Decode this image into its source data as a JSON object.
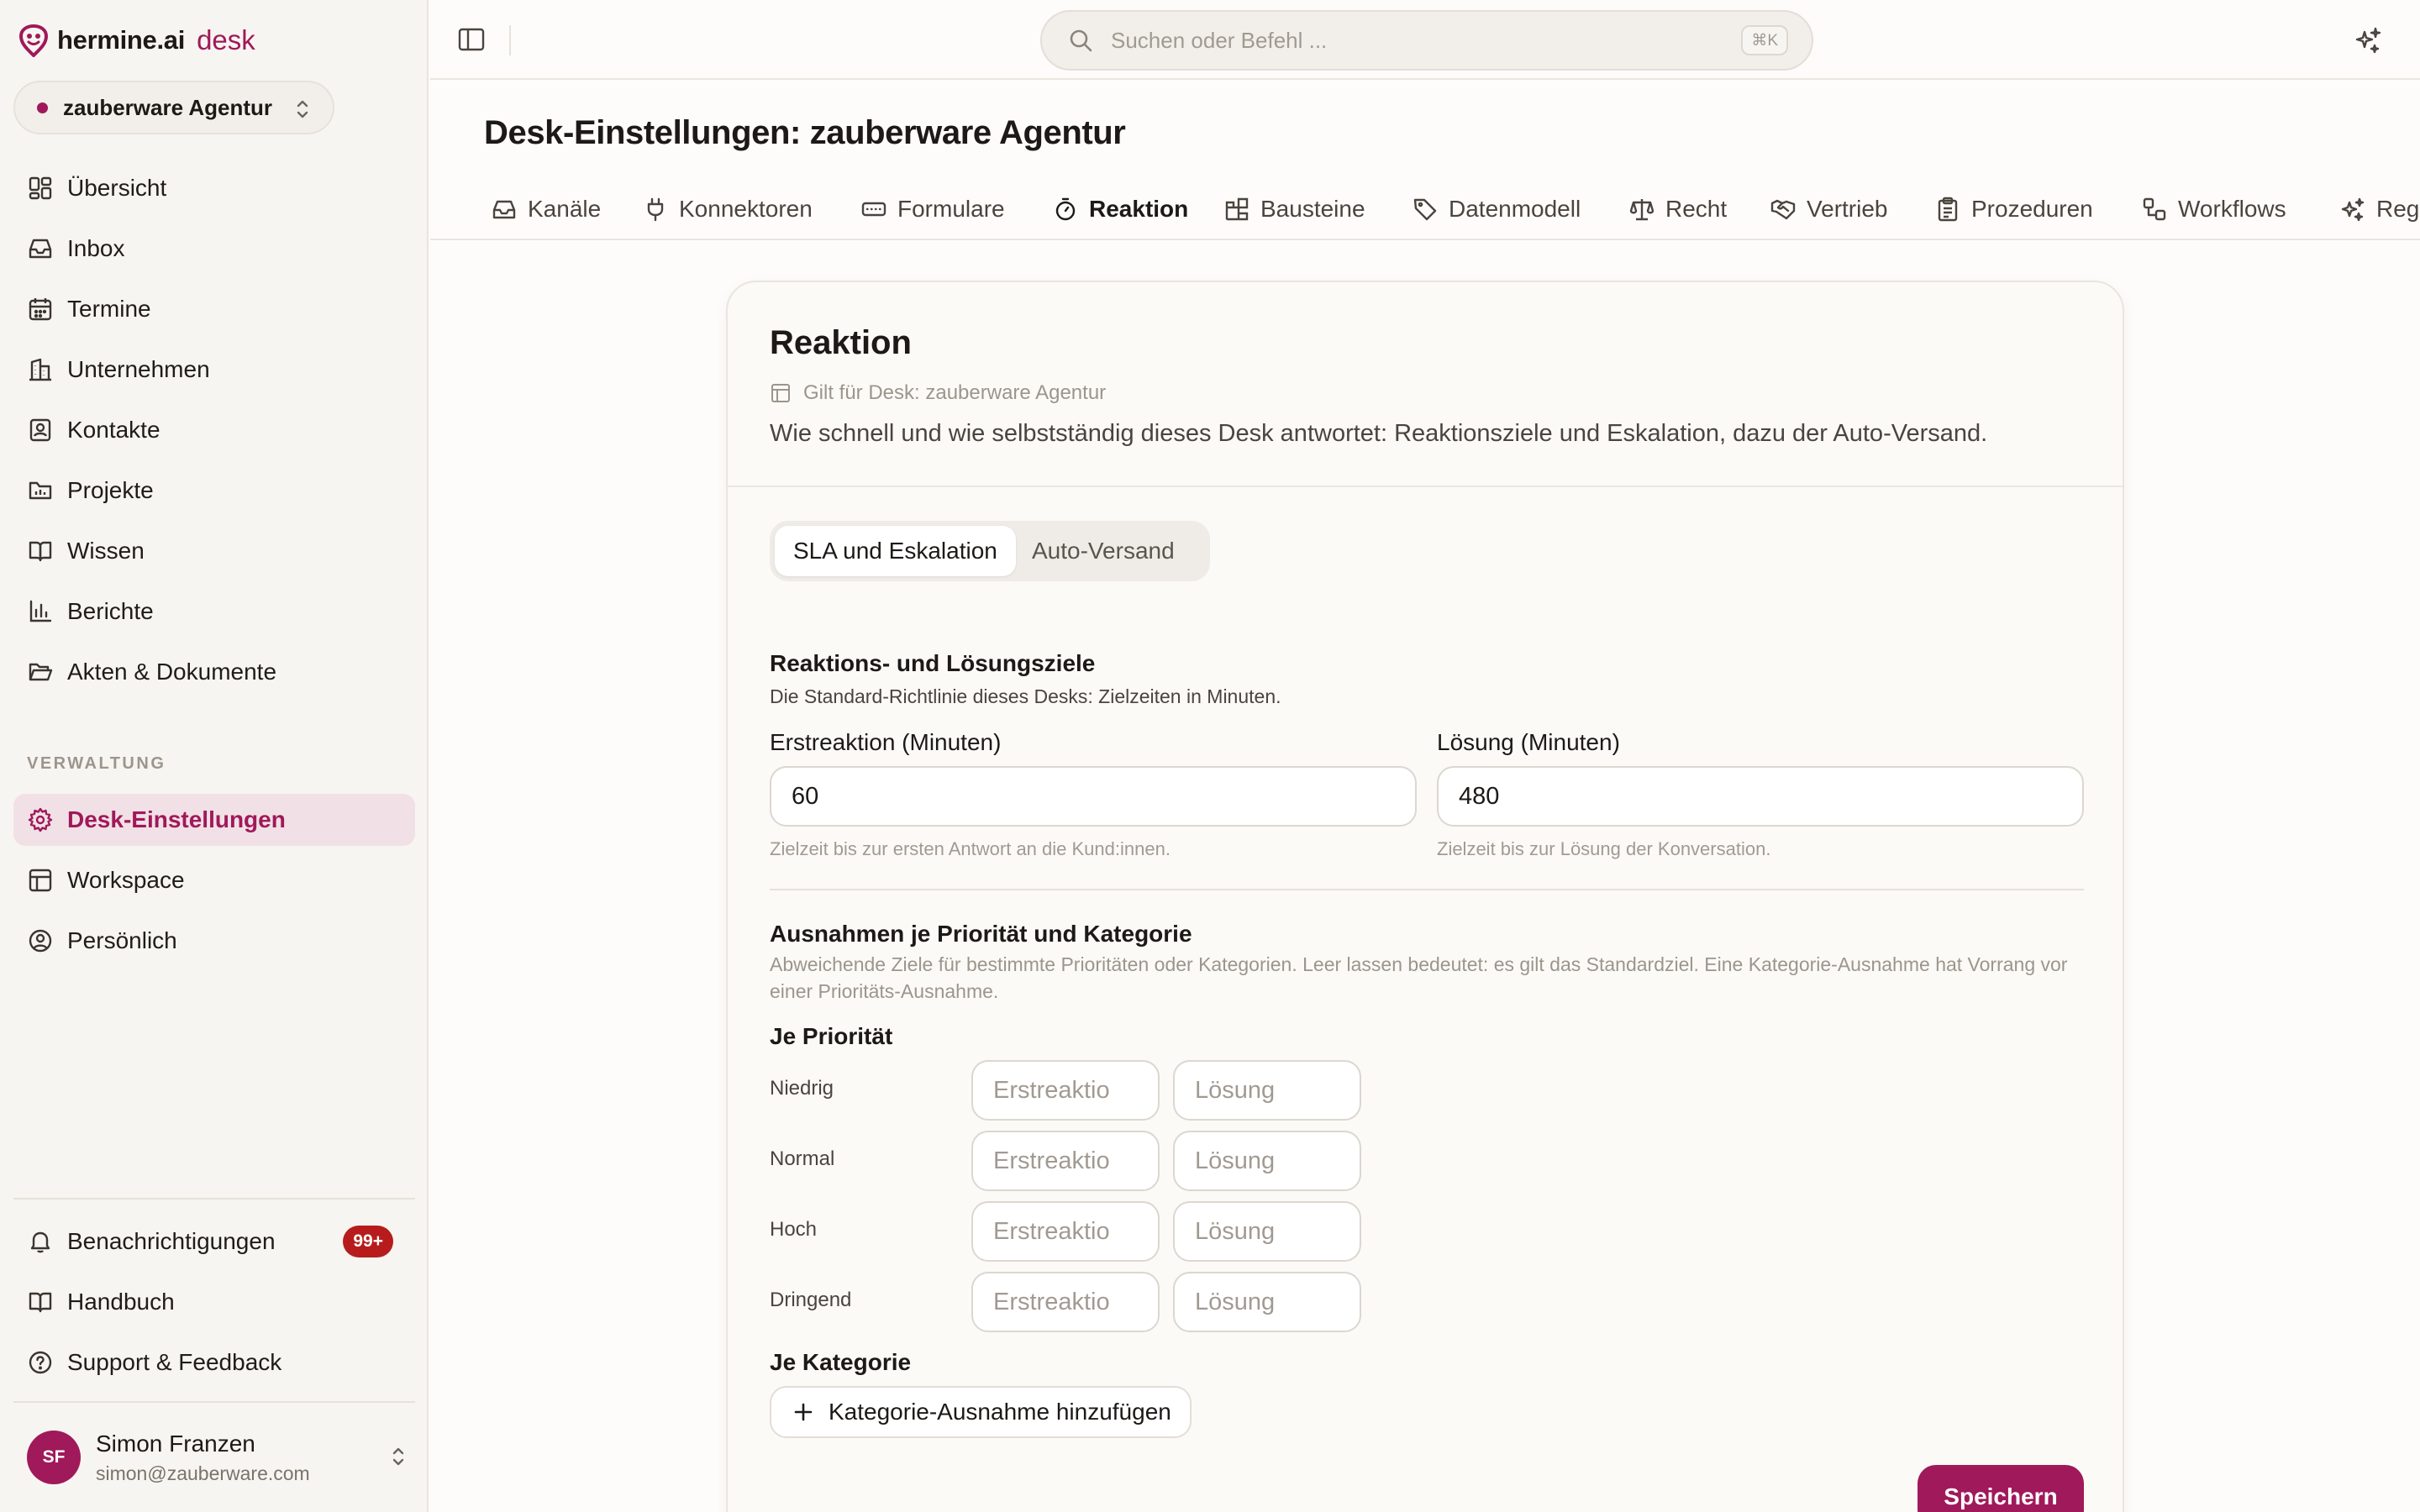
{
  "brand": {
    "name": "hermine.ai",
    "product": "desk"
  },
  "org_switcher": {
    "name": "zauberware Agentur"
  },
  "nav": [
    {
      "label": "Übersicht",
      "icon": "dashboard-icon"
    },
    {
      "label": "Inbox",
      "icon": "inbox-icon"
    },
    {
      "label": "Termine",
      "icon": "calendar-icon"
    },
    {
      "label": "Unternehmen",
      "icon": "building-icon"
    },
    {
      "label": "Kontakte",
      "icon": "contact-icon"
    },
    {
      "label": "Projekte",
      "icon": "folder-chart-icon"
    },
    {
      "label": "Wissen",
      "icon": "book-icon"
    },
    {
      "label": "Berichte",
      "icon": "bar-chart-icon"
    },
    {
      "label": "Akten & Dokumente",
      "icon": "folder-open-icon"
    }
  ],
  "admin_section": {
    "label": "VERWALTUNG",
    "items": [
      {
        "label": "Desk-Einstellungen",
        "icon": "gear-icon",
        "active": true
      },
      {
        "label": "Workspace",
        "icon": "layout-icon"
      },
      {
        "label": "Persönlich",
        "icon": "user-circle-icon"
      }
    ]
  },
  "bottom_nav": [
    {
      "label": "Benachrichtigungen",
      "icon": "bell-icon",
      "badge": "99+"
    },
    {
      "label": "Handbuch",
      "icon": "book-icon"
    },
    {
      "label": "Support & Feedback",
      "icon": "help-circle-icon"
    }
  ],
  "user": {
    "initials": "SF",
    "name": "Simon Franzen",
    "email": "simon@zauberware.com"
  },
  "search": {
    "placeholder": "Suchen oder Befehl ...",
    "shortcut": "⌘K"
  },
  "page": {
    "title": "Desk-Einstellungen: zauberware Agentur"
  },
  "tabs": [
    {
      "label": "Kanäle",
      "icon": "inbox-icon"
    },
    {
      "label": "Konnektoren",
      "icon": "plug-icon"
    },
    {
      "label": "Formulare",
      "icon": "form-icon"
    },
    {
      "label": "Reaktion",
      "icon": "timer-icon",
      "active": true
    },
    {
      "label": "Bausteine",
      "icon": "blocks-icon"
    },
    {
      "label": "Datenmodell",
      "icon": "tag-icon"
    },
    {
      "label": "Recht",
      "icon": "scale-icon"
    },
    {
      "label": "Vertrieb",
      "icon": "handshake-icon"
    },
    {
      "label": "Prozeduren",
      "icon": "clipboard-icon"
    },
    {
      "label": "Workflows",
      "icon": "workflow-icon"
    },
    {
      "label": "Reg",
      "icon": "sparkle-icon"
    }
  ],
  "card": {
    "title": "Reaktion",
    "scope": "Gilt für Desk: zauberware Agentur",
    "description": "Wie schnell und wie selbstständig dieses Desk antwortet: Reaktionsziele und Eskalation, dazu der Auto-Versand.",
    "segments": [
      {
        "label": "SLA und Eskalation",
        "active": true
      },
      {
        "label": "Auto-Versand"
      }
    ],
    "targets": {
      "title": "Reaktions- und Lösungsziele",
      "subtitle": "Die Standard-Richtlinie dieses Desks: Zielzeiten in Minuten.",
      "first_response": {
        "label": "Erstreaktion (Minuten)",
        "value": "60",
        "help": "Zielzeit bis zur ersten Antwort an die Kund:innen."
      },
      "resolution": {
        "label": "Lösung (Minuten)",
        "value": "480",
        "help": "Zielzeit bis zur Lösung der Konversation."
      }
    },
    "exceptions": {
      "title": "Ausnahmen je Priorität und Kategorie",
      "description": "Abweichende Ziele für bestimmte Prioritäten oder Kategorien. Leer lassen bedeutet: es gilt das Standardziel. Eine Kategorie-Ausnahme hat Vorrang vor einer Prioritäts-Ausnahme.",
      "by_priority_title": "Je Priorität",
      "priorities": [
        {
          "label": "Niedrig",
          "first_placeholder": "Erstreaktio",
          "resolution_placeholder": "Lösung"
        },
        {
          "label": "Normal",
          "first_placeholder": "Erstreaktio",
          "resolution_placeholder": "Lösung"
        },
        {
          "label": "Hoch",
          "first_placeholder": "Erstreaktio",
          "resolution_placeholder": "Lösung"
        },
        {
          "label": "Dringend",
          "first_placeholder": "Erstreaktio",
          "resolution_placeholder": "Lösung"
        }
      ],
      "by_category_title": "Je Kategorie",
      "add_category_label": "Kategorie-Ausnahme hinzufügen"
    },
    "save_label": "Speichern"
  },
  "colors": {
    "accent": "#a0195a",
    "badge": "#b71c1c",
    "sidebar_bg": "#f7f5f1",
    "active_nav_bg": "#f1e1e6"
  }
}
